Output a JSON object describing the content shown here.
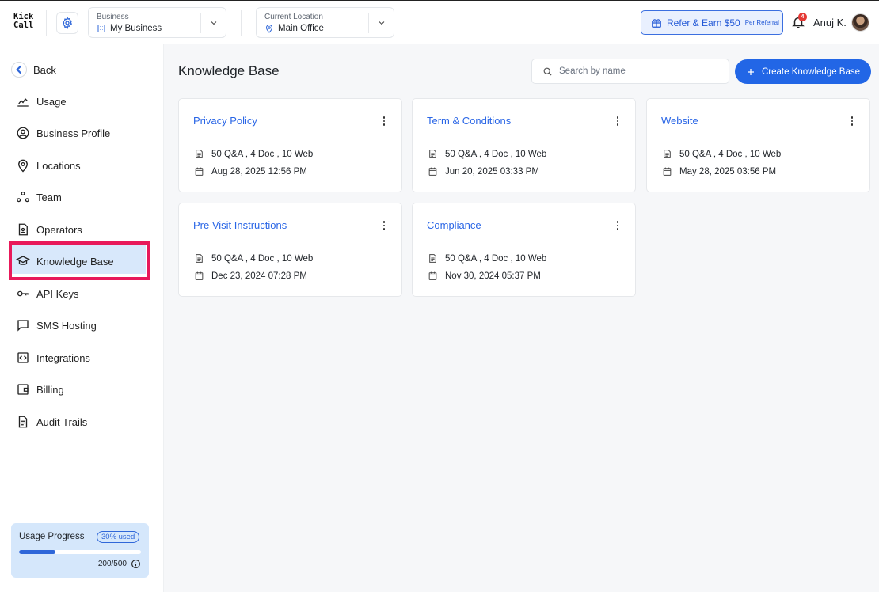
{
  "header": {
    "logo_line1": "Kick",
    "logo_line2": "Call",
    "business": {
      "label": "Business",
      "value": "My Business"
    },
    "location": {
      "label": "Current Location",
      "value": "Main Office"
    },
    "refer": {
      "label": "Refer & Earn $50",
      "sub": "Per Referral"
    },
    "notifications_count": "4",
    "user_name": "Anuj K."
  },
  "sidebar": {
    "back_label": "Back",
    "items": [
      {
        "label": "Usage",
        "icon": "chart-icon"
      },
      {
        "label": "Business Profile",
        "icon": "user-circle-icon"
      },
      {
        "label": "Locations",
        "icon": "pin-icon"
      },
      {
        "label": "Team",
        "icon": "team-icon"
      },
      {
        "label": "Operators",
        "icon": "operator-icon"
      },
      {
        "label": "Knowledge Base",
        "icon": "graduation-cap-icon",
        "active": true
      },
      {
        "label": "API Keys",
        "icon": "key-icon"
      },
      {
        "label": "SMS Hosting",
        "icon": "message-icon"
      },
      {
        "label": "Integrations",
        "icon": "code-icon"
      },
      {
        "label": "Billing",
        "icon": "wallet-icon"
      },
      {
        "label": "Audit Trails",
        "icon": "document-icon"
      }
    ],
    "usage": {
      "title": "Usage Progress",
      "badge": "30% used",
      "fraction": 0.3,
      "count": "200/500"
    }
  },
  "main": {
    "title": "Knowledge Base",
    "search_placeholder": "Search by name",
    "create_label": "Create Knowledge Base",
    "cards": [
      {
        "title": "Privacy Policy",
        "stats": "50 Q&A , 4 Doc , 10 Web",
        "date": "Aug 28, 2025 12:56 PM"
      },
      {
        "title": "Term & Conditions",
        "stats": "50 Q&A , 4 Doc , 10 Web",
        "date": "Jun 20, 2025 03:33 PM"
      },
      {
        "title": "Website",
        "stats": "50 Q&A , 4 Doc , 10 Web",
        "date": "May 28, 2025 03:56 PM"
      },
      {
        "title": "Pre Visit Instructions",
        "stats": "50 Q&A , 4 Doc , 10 Web",
        "date": "Dec 23, 2024 07:28 PM"
      },
      {
        "title": "Compliance",
        "stats": "50 Q&A , 4 Doc , 10 Web",
        "date": "Nov 30, 2024 05:37 PM"
      }
    ]
  },
  "colors": {
    "accent": "#2266e6",
    "active_highlight": "#e8195a",
    "active_bg": "#d8e8fb"
  }
}
